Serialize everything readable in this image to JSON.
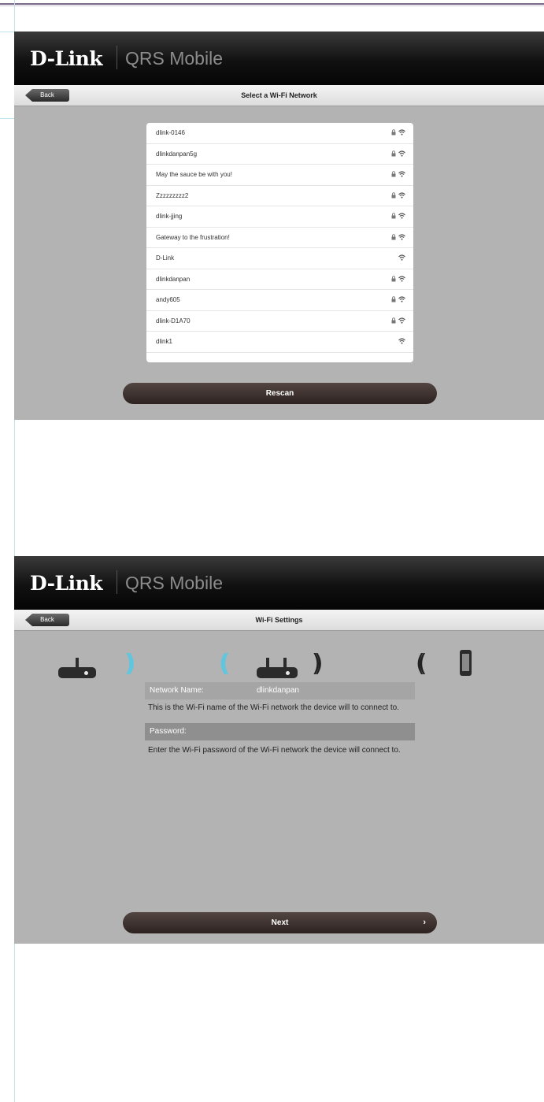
{
  "screen1": {
    "brand": "D-Link",
    "app_name": "QRS Mobile",
    "back_label": "Back",
    "title": "Select a Wi-Fi Network",
    "networks": [
      {
        "name": "dlink-0146",
        "locked": true
      },
      {
        "name": "dlinkdanpan5g",
        "locked": true
      },
      {
        "name": "May the sauce be with you!",
        "locked": true
      },
      {
        "name": "Zzzzzzzzz2",
        "locked": true
      },
      {
        "name": "dlink-jjing",
        "locked": true
      },
      {
        "name": "Gateway to the frustration!",
        "locked": true
      },
      {
        "name": "D-Link",
        "locked": false
      },
      {
        "name": "dlinkdanpan",
        "locked": true
      },
      {
        "name": "andy605",
        "locked": true
      },
      {
        "name": "dlink-D1A70",
        "locked": true
      },
      {
        "name": "dlink1",
        "locked": false
      }
    ],
    "rescan_label": "Rescan"
  },
  "screen2": {
    "brand": "D-Link",
    "app_name": "QRS Mobile",
    "back_label": "Back",
    "title": "Wi-Fi Settings",
    "network_name_label": "Network Name:",
    "network_name_value": "dlinkdanpan",
    "network_help": "This is the Wi-Fi name of the Wi-Fi network the device will to connect to.",
    "password_label": "Password:",
    "password_help": "Enter the Wi-Fi password of the Wi-Fi network the device will connect to.",
    "next_label": "Next",
    "next_chevron": "›"
  },
  "icons": {
    "lock": "🔒",
    "wifi": "⌔"
  },
  "colors": {
    "screen_bg": "#b3b3b3",
    "header_bg": "#111111",
    "button_bg": "#3c302d",
    "wave_blue": "#5ec7df"
  }
}
